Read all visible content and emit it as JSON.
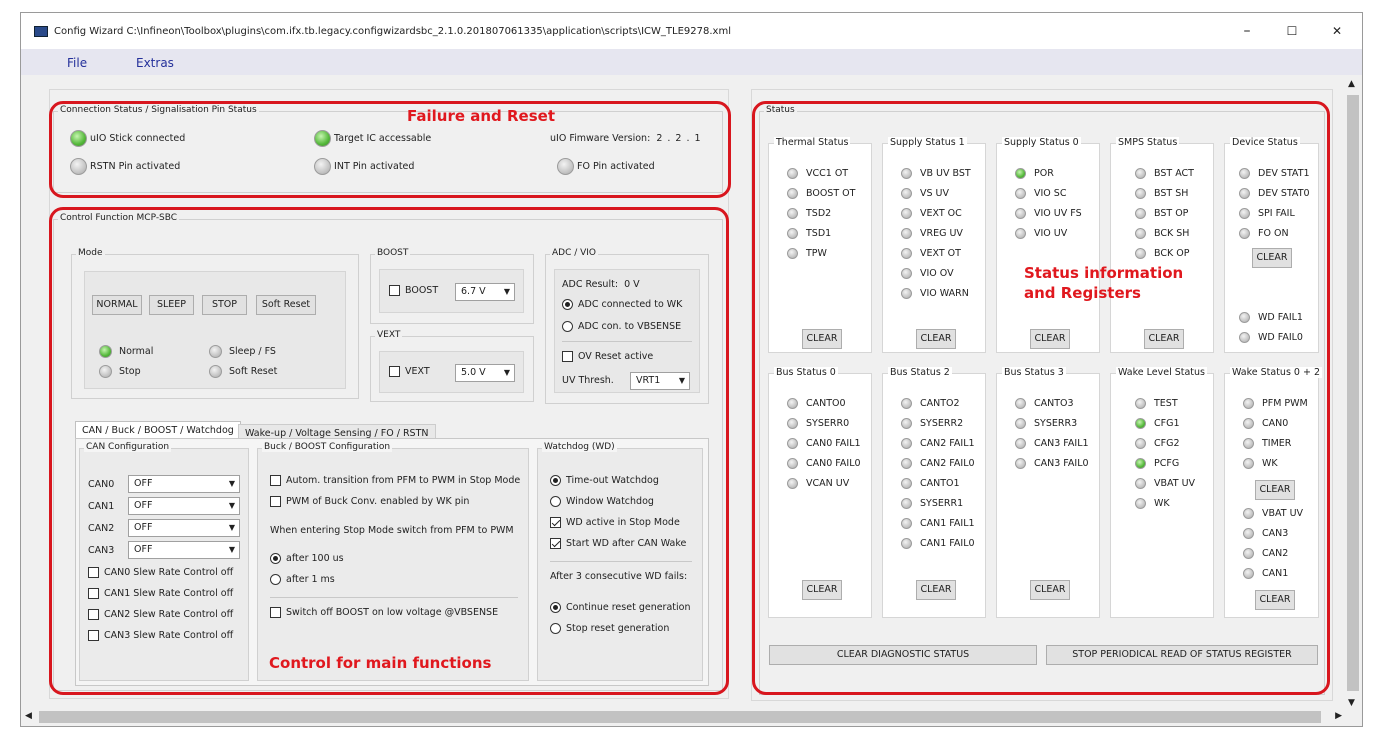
{
  "window": {
    "title": "Config Wizard C:\\Infineon\\Toolbox\\plugins\\com.ifx.tb.legacy.configwizardsbc_2.1.0.201807061335\\application\\scripts\\ICW_TLE9278.xml",
    "minimize": "–",
    "maximize": "☐",
    "close": "✕"
  },
  "menu": {
    "file": "File",
    "extras": "Extras"
  },
  "annotations": {
    "failure_reset": "Failure and Reset",
    "control_main": "Control for main functions",
    "status_info_line1": "Status information",
    "status_info_line2": "and Registers"
  },
  "connection": {
    "title": "Connection Status / Signalisation Pin Status",
    "uio_stick": "uIO Stick connected",
    "target_ic": "Target IC accessable",
    "fw_label": "uIO Fimware Version:",
    "fw_version": "2 . 2 . 1",
    "rstn": "RSTN Pin activated",
    "int": "INT Pin activated",
    "fo": "FO Pin activated"
  },
  "control": {
    "title": "Control Function MCP-SBC",
    "mode": {
      "title": "Mode",
      "btn_normal": "NORMAL",
      "btn_sleep": "SLEEP",
      "btn_stop": "STOP",
      "btn_soft_reset": "Soft Reset",
      "ind_normal": "Normal",
      "ind_sleep": "Sleep / FS",
      "ind_stop": "Stop",
      "ind_soft_reset": "Soft Reset"
    },
    "boost": {
      "title": "BOOST",
      "label": "BOOST",
      "value": "6.7 V"
    },
    "vext": {
      "title": "VEXT",
      "label": "VEXT",
      "value": "5.0 V"
    },
    "adc": {
      "title": "ADC / VIO",
      "result_label": "ADC Result:",
      "result_value": "0 V",
      "opt_wk": "ADC connected to WK",
      "opt_vbsense": "ADC con. to VBSENSE",
      "ov_reset": "OV Reset active",
      "uv_label": "UV Thresh.",
      "uv_value": "VRT1"
    },
    "tabs": {
      "tab1": "CAN / Buck / BOOST / Watchdog",
      "tab2": "Wake-up / Voltage Sensing / FO / RSTN"
    },
    "can_config": {
      "title": "CAN Configuration",
      "rows": [
        {
          "label": "CAN0",
          "value": "OFF"
        },
        {
          "label": "CAN1",
          "value": "OFF"
        },
        {
          "label": "CAN2",
          "value": "OFF"
        },
        {
          "label": "CAN3",
          "value": "OFF"
        }
      ],
      "slew": [
        "CAN0 Slew Rate Control off",
        "CAN1 Slew Rate Control off",
        "CAN2 Slew Rate Control off",
        "CAN3 Slew Rate Control off"
      ]
    },
    "buck": {
      "title": "Buck / BOOST Configuration",
      "autom": "Autom. transition from PFM to PWM in Stop Mode",
      "pwm_wk": "PWM of Buck Conv. enabled by WK pin",
      "stop_text": "When entering Stop Mode switch from PFM to PWM",
      "after100": "after 100 us",
      "after1ms": "after 1 ms",
      "switch_off": "Switch off BOOST on low voltage @VBSENSE"
    },
    "wd": {
      "title": "Watchdog (WD)",
      "timeout": "Time-out Watchdog",
      "window": "Window Watchdog",
      "active_stop": "WD active in Stop Mode",
      "start_can": "Start WD after CAN Wake",
      "after3": "After 3 consecutive WD fails:",
      "continue": "Continue reset generation",
      "stop": "Stop reset generation"
    }
  },
  "status": {
    "title": "Status",
    "clear": "CLEAR",
    "clear_diag": "CLEAR DIAGNOSTIC STATUS",
    "stop_periodical": "STOP PERIODICAL READ OF STATUS REGISTER",
    "thermal": {
      "title": "Thermal Status",
      "items": [
        "VCC1 OT",
        "BOOST OT",
        "TSD2",
        "TSD1",
        "TPW"
      ]
    },
    "supply1": {
      "title": "Supply Status 1",
      "items": [
        "VB UV BST",
        "VS UV",
        "VEXT OC",
        "VREG UV",
        "VEXT OT",
        "VIO OV",
        "VIO WARN"
      ]
    },
    "supply0": {
      "title": "Supply Status 0",
      "items": [
        "POR",
        "VIO SC",
        "VIO UV FS",
        "VIO UV"
      ]
    },
    "smps": {
      "title": "SMPS Status",
      "items": [
        "BST ACT",
        "BST SH",
        "BST OP",
        "BCK SH",
        "BCK OP"
      ]
    },
    "device": {
      "title": "Device Status",
      "items": [
        "DEV STAT1",
        "DEV STAT0",
        "SPI FAIL",
        "FO ON"
      ],
      "items2": [
        "WD FAIL1",
        "WD FAIL0"
      ]
    },
    "bus0": {
      "title": "Bus Status 0",
      "items": [
        "CANTO0",
        "SYSERR0",
        "CAN0 FAIL1",
        "CAN0 FAIL0",
        "VCAN UV"
      ]
    },
    "bus2": {
      "title": "Bus Status 2",
      "items": [
        "CANTO2",
        "SYSERR2",
        "CAN2 FAIL1",
        "CAN2 FAIL0",
        "CANTO1",
        "SYSERR1",
        "CAN1 FAIL1",
        "CAN1 FAIL0"
      ]
    },
    "bus3": {
      "title": "Bus Status 3",
      "items": [
        "CANTO3",
        "SYSERR3",
        "CAN3 FAIL1",
        "CAN3 FAIL0"
      ]
    },
    "wakelevel": {
      "title": "Wake Level Status",
      "items": [
        "TEST",
        "CFG1",
        "CFG2",
        "PCFG",
        "VBAT UV",
        "WK"
      ]
    },
    "wake02": {
      "title": "Wake Status 0 + 2",
      "items": [
        "PFM PWM",
        "CAN0",
        "TIMER",
        "WK"
      ],
      "items2": [
        "VBAT UV",
        "CAN3",
        "CAN2",
        "CAN1"
      ]
    }
  }
}
